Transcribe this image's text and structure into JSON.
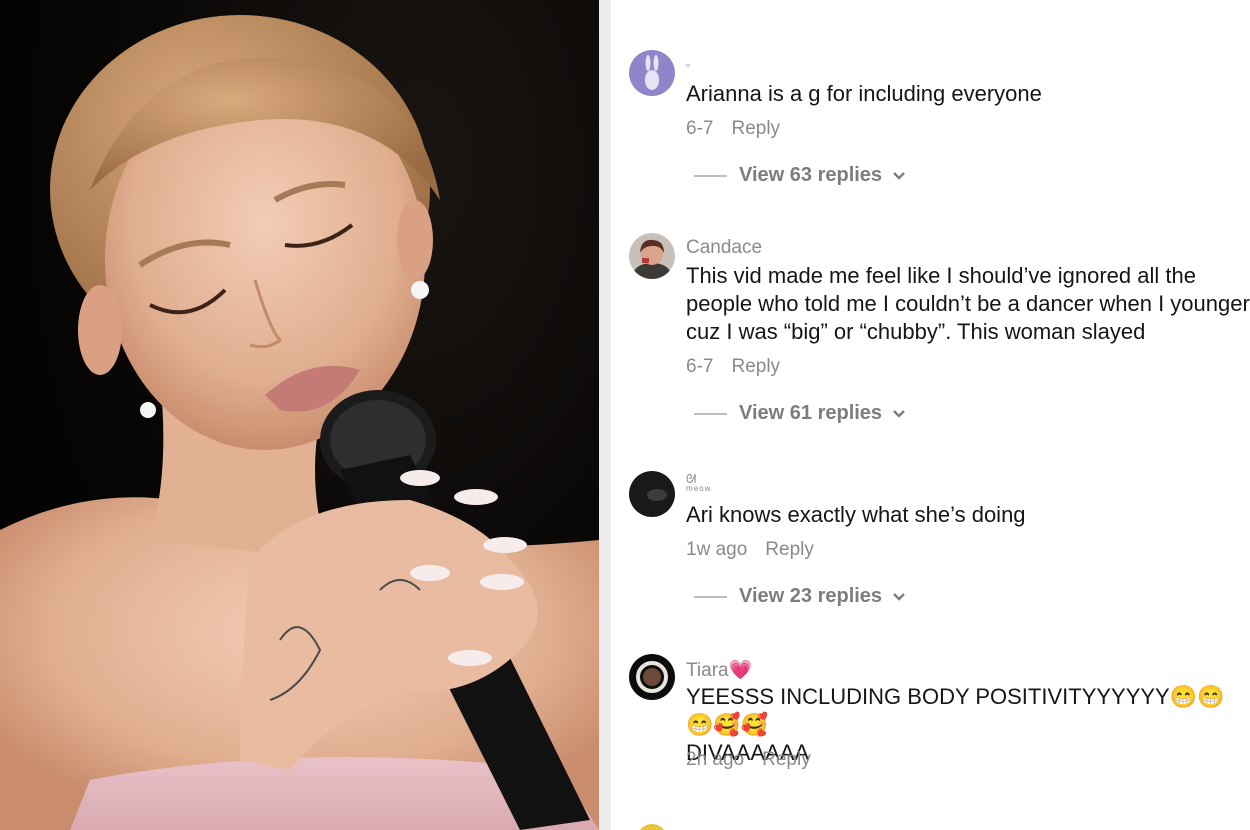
{
  "comments": [
    {
      "username": "▫",
      "text": "Arianna is a g for including everyone",
      "time": "6-7",
      "reply_label": "Reply",
      "view_replies": "View 63 replies",
      "avatar_icon": "bunny-avatar-icon"
    },
    {
      "username": "Candace",
      "text": "This vid made me feel like I should’ve ignored all the\npeople who told me I couldn’t be a dancer when I younger\ncuz I was “big” or “chubby”. This woman slayed",
      "time": "6-7",
      "reply_label": "Reply",
      "view_replies": "View 61 replies",
      "avatar_icon": "selfie-avatar-icon"
    },
    {
      "username": "ᘛ",
      "username_sub": "meow",
      "text": "Ari knows exactly what she’s doing",
      "time": "1w ago",
      "reply_label": "Reply",
      "view_replies": "View 23 replies",
      "avatar_icon": "dark-avatar-icon"
    },
    {
      "username": "Tiara💗",
      "text": "YEESSS INCLUDING BODY POSITIVITYYYYYY😁😁😁🥰🥰\nDIVAAAAAA",
      "time": "2h ago",
      "reply_label": "Reply",
      "avatar_icon": "ring-avatar-icon"
    }
  ],
  "colors": {
    "text": "#161616",
    "muted": "#8a8a8a",
    "divider": "#ececec"
  }
}
